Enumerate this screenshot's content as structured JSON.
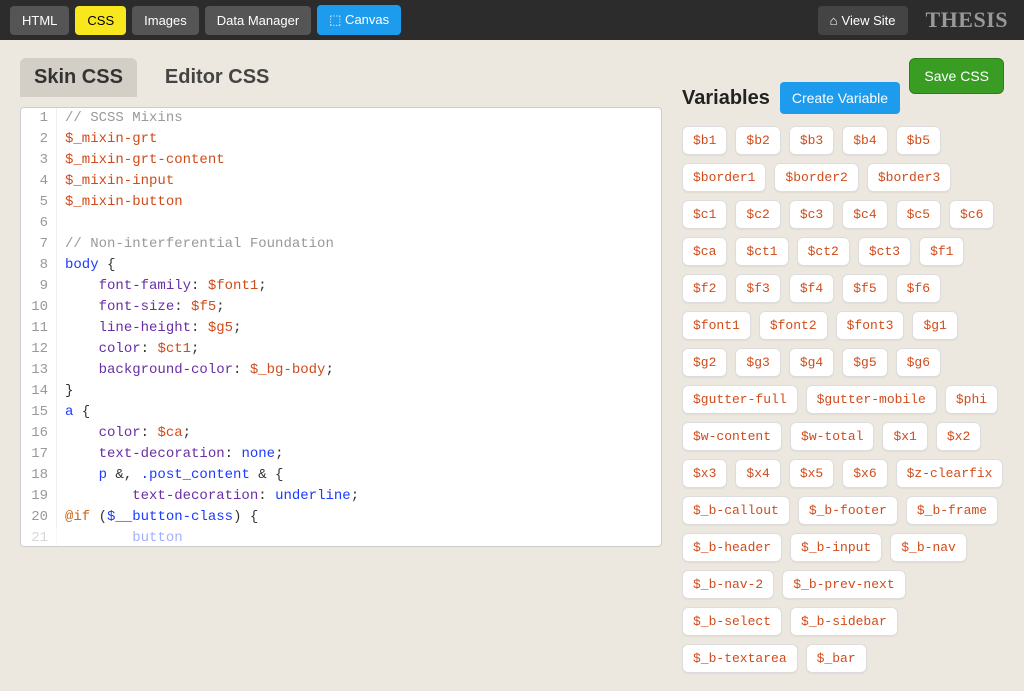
{
  "nav": {
    "html": "HTML",
    "css": "CSS",
    "images": "Images",
    "data_manager": "Data Manager",
    "canvas": "⬚ Canvas",
    "view_site": "View Site"
  },
  "logo": "THESIS",
  "tabs": {
    "skin": "Skin CSS",
    "editor": "Editor CSS"
  },
  "save": "Save CSS",
  "code": {
    "l1_a": "// ",
    "l1_b": "SCSS Mixins",
    "l2": "$_mixin-grt",
    "l3": "$_mixin-grt-content",
    "l4": "$_mixin-input",
    "l5": "$_mixin-button",
    "l7_a": "// ",
    "l7_b": "Non-interferential Foundation",
    "l8_a": "body",
    "l8_b": " {",
    "l9_a": "    ",
    "l9_b": "font-family",
    "l9_c": ": ",
    "l9_d": "$font1",
    "l9_e": ";",
    "l10_a": "    ",
    "l10_b": "font-size",
    "l10_c": ": ",
    "l10_d": "$f5",
    "l10_e": ";",
    "l11_a": "    ",
    "l11_b": "line-height",
    "l11_c": ": ",
    "l11_d": "$g5",
    "l11_e": ";",
    "l12_a": "    ",
    "l12_b": "color",
    "l12_c": ": ",
    "l12_d": "$ct1",
    "l12_e": ";",
    "l13_a": "    ",
    "l13_b": "background-color",
    "l13_c": ": ",
    "l13_d": "$_bg-body",
    "l13_e": ";",
    "l14": "}",
    "l15_a": "a",
    "l15_b": " {",
    "l16_a": "    ",
    "l16_b": "color",
    "l16_c": ": ",
    "l16_d": "$ca",
    "l16_e": ";",
    "l17_a": "    ",
    "l17_b": "text-decoration",
    "l17_c": ": ",
    "l17_d": "none",
    "l17_e": ";",
    "l18_a": "    ",
    "l18_b": "p",
    "l18_c": " &, ",
    "l18_d": ".post_content",
    "l18_e": " & {",
    "l19_a": "        ",
    "l19_b": "text-decoration",
    "l19_c": ": ",
    "l19_d": "underline",
    "l19_e": ";",
    "l20_a": "@if",
    "l20_b": " (",
    "l20_c": "$__button-class",
    "l20_d": ") {",
    "l21_a": "        ",
    "l21_b": "button"
  },
  "ln": {
    "1": "1",
    "2": "2",
    "3": "3",
    "4": "4",
    "5": "5",
    "6": "6",
    "7": "7",
    "8": "8",
    "9": "9",
    "10": "10",
    "11": "11",
    "12": "12",
    "13": "13",
    "14": "14",
    "15": "15",
    "16": "16",
    "17": "17",
    "18": "18",
    "19": "19",
    "20": "20",
    "21": "21"
  },
  "vars": {
    "title": "Variables",
    "create": "Create Variable",
    "list": [
      "$b1",
      "$b2",
      "$b3",
      "$b4",
      "$b5",
      "$border1",
      "$border2",
      "$border3",
      "$c1",
      "$c2",
      "$c3",
      "$c4",
      "$c5",
      "$c6",
      "$ca",
      "$ct1",
      "$ct2",
      "$ct3",
      "$f1",
      "$f2",
      "$f3",
      "$f4",
      "$f5",
      "$f6",
      "$font1",
      "$font2",
      "$font3",
      "$g1",
      "$g2",
      "$g3",
      "$g4",
      "$g5",
      "$g6",
      "$gutter-full",
      "$gutter-mobile",
      "$phi",
      "$w-content",
      "$w-total",
      "$x1",
      "$x2",
      "$x3",
      "$x4",
      "$x5",
      "$x6",
      "$z-clearfix",
      "$_b-callout",
      "$_b-footer",
      "$_b-frame",
      "$_b-header",
      "$_b-input",
      "$_b-nav",
      "$_b-nav-2",
      "$_b-prev-next",
      "$_b-select",
      "$_b-sidebar",
      "$_b-textarea",
      "$_bar"
    ]
  }
}
